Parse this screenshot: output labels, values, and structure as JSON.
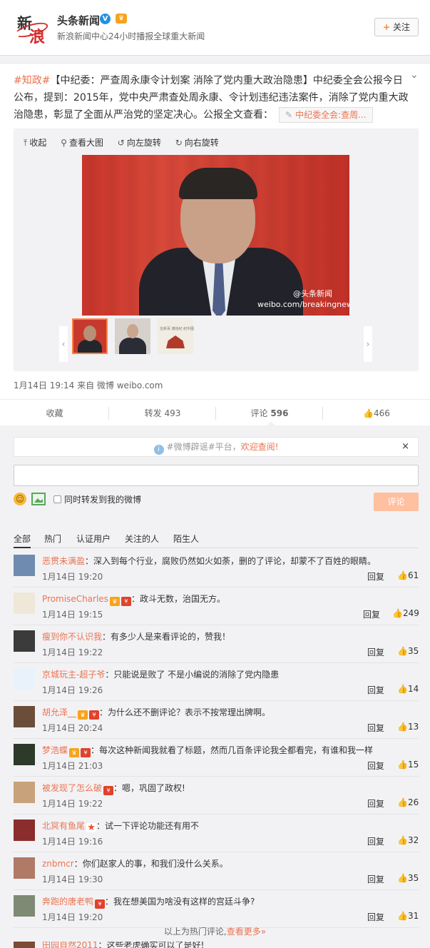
{
  "account": {
    "logo_char1": "新",
    "logo_char2": "浪",
    "name": "头条新闻",
    "verified": "V",
    "description": "新浪新闻中心24小时播报全球重大新闻",
    "follow_label": "关注",
    "follow_icon": "+"
  },
  "post": {
    "tag": "#知政#",
    "text": "【中纪委：严查周永康令计划案 消除了党内重大政治隐患】中纪委全会公报今日公布，提到：2015年，党中央严肃查处周永康、令计划违纪违法案件，消除了党内重大政治隐患，彰显了全面从严治党的坚定决心。公报全文查看：",
    "link_label": "中纪委全会:查周...",
    "media_tools": [
      {
        "label": "收起",
        "icon": "collapse-icon",
        "glyph": "⤒"
      },
      {
        "label": "查看大图",
        "icon": "magnify-icon",
        "glyph": "⚲"
      },
      {
        "label": "向左旋转",
        "icon": "rotate-left-icon",
        "glyph": "↺"
      },
      {
        "label": "向右旋转",
        "icon": "rotate-right-icon",
        "glyph": "↻"
      }
    ],
    "watermark_account": "@头条新闻",
    "watermark_url": "weibo.com/breakingnews",
    "thumb3_text": "在新百 遵违纪 纪中图",
    "meta": "1月14日 19:14 来自 微博 weibo.com",
    "actions": {
      "collect": "收藏",
      "repost_label": "转发",
      "repost_count": "493",
      "comment_label": "评论",
      "comment_count": "596",
      "like_count": "466"
    }
  },
  "notice": {
    "text": "#微博辟谣#平台，",
    "link": "欢迎查阅!",
    "close": "×"
  },
  "compose": {
    "input_value": "",
    "repost_checkbox_label": "同时转发到我的微博",
    "submit_label": "评论"
  },
  "filters": [
    "全部",
    "热门",
    "认证用户",
    "关注的人",
    "陌生人"
  ],
  "comments": [
    {
      "user": "恶贯未满盈",
      "text": "：深入到每个行业，腐败仍然如火如荼，删的了评论，却蒙不了百姓的眼睛。",
      "time": "1月14日 19:20",
      "reply": "回复",
      "likes": "61",
      "avatar_color": "#6f8bb0",
      "badges": []
    },
    {
      "user": "PromiseCharles",
      "text": "：政斗无数，治国无方。",
      "time": "1月14日 19:15",
      "reply": "回复",
      "likes": "249",
      "avatar_color": "#efe8d8",
      "badges": [
        "vip",
        "red"
      ]
    },
    {
      "user": "瘦到你不认识我",
      "text": "：有多少人是来看评论的，赞我！",
      "time": "1月14日 19:22",
      "reply": "回复",
      "likes": "35",
      "avatar_color": "#3b3b3b",
      "badges": []
    },
    {
      "user": "京城玩主-超子爷",
      "text": "：只能说是败了 不是小编说的消除了党内隐患",
      "time": "1月14日 19:26",
      "reply": "回复",
      "likes": "14",
      "avatar_color": "#e9f2fb",
      "badges": []
    },
    {
      "user": "胡允泽__",
      "text": "：为什么还不删评论？表示不按常理出牌啊。",
      "time": "1月14日 20:24",
      "reply": "回复",
      "likes": "13",
      "avatar_color": "#6a4e3a",
      "badges": [
        "vip",
        "red"
      ]
    },
    {
      "user": "梦浩蝶",
      "text": "：每次这种新闻我就看了标题，然而几百条评论我全都看完，有谁和我一样",
      "time": "1月14日 21:03",
      "reply": "回复",
      "likes": "15",
      "avatar_color": "#2d3a2a",
      "badges": [
        "vip",
        "red"
      ]
    },
    {
      "user": "被发现了怎么破",
      "text": "：嗯，巩固了政权!",
      "time": "1月14日 19:22",
      "reply": "回复",
      "likes": "26",
      "avatar_color": "#c7a27a",
      "badges": [
        "red"
      ]
    },
    {
      "user": "北冥有鱼尾",
      "text": "：试一下评论功能还有用不",
      "time": "1月14日 19:16",
      "reply": "回复",
      "likes": "32",
      "avatar_color": "#8b2d2d",
      "badges": [
        "star"
      ]
    },
    {
      "user": "znbmcr",
      "text": "：你们赵家人的事，和我们没什么关系。",
      "time": "1月14日 19:30",
      "reply": "回复",
      "likes": "35",
      "avatar_color": "#b07a66",
      "badges": []
    },
    {
      "user": "奔跑的唐老鸭",
      "text": "：我在想美国为啥没有这样的宫廷斗争?",
      "time": "1月14日 19:20",
      "reply": "回复",
      "likes": "31",
      "avatar_color": "#7e8a74",
      "badges": [
        "red"
      ]
    }
  ],
  "more": {
    "text": "以上为热门评论,",
    "link": "查看更多»"
  },
  "partial_comment": {
    "user": "田园自然2011",
    "text": "：这些老虎确实可以了是好!"
  },
  "colors": {
    "accent": "#eb7350",
    "link_orange": "#ff8140",
    "verified_blue": "#1e90e6",
    "background": "#f2f2f5"
  }
}
